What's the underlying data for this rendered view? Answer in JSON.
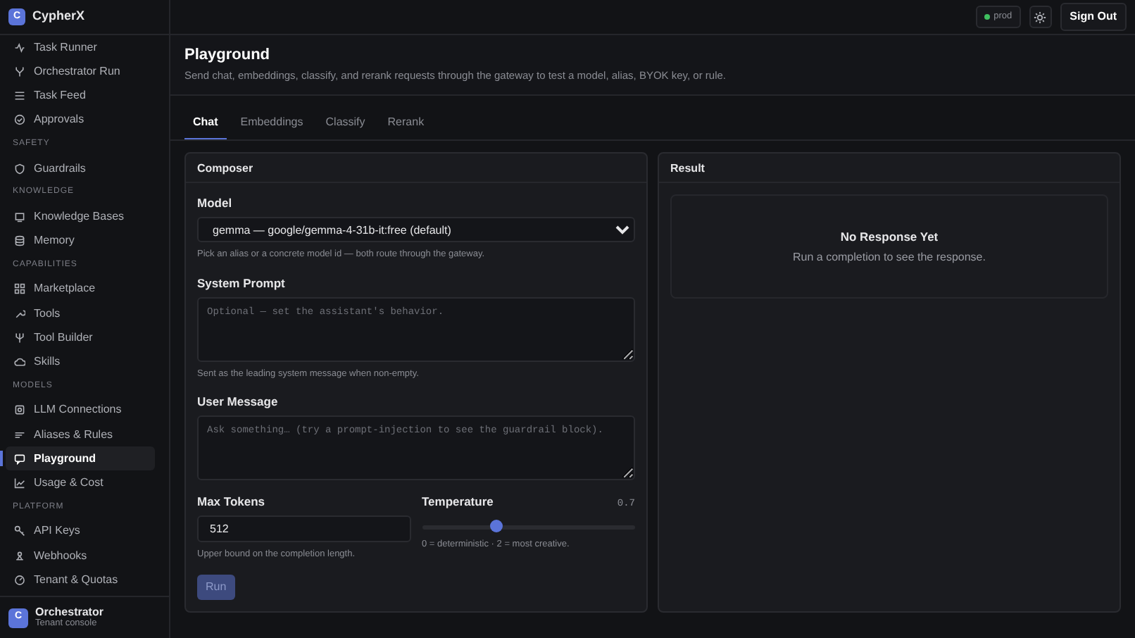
{
  "sidebar": {
    "brand": {
      "logo": "C",
      "name": "CypherX"
    },
    "sections": [
      {
        "items": [
          {
            "label": "Task Runner",
            "selected": false
          },
          {
            "label": "Orchestrator Run",
            "selected": false
          },
          {
            "label": "Task Feed",
            "selected": false
          },
          {
            "label": "Approvals",
            "selected": false
          }
        ]
      },
      {
        "heading": "SAFETY",
        "items": [
          {
            "label": "Guardrails",
            "selected": false
          }
        ]
      },
      {
        "heading": "KNOWLEDGE",
        "items": [
          {
            "label": "Knowledge Bases",
            "selected": false
          },
          {
            "label": "Memory",
            "selected": false
          }
        ]
      },
      {
        "heading": "CAPABILITIES",
        "items": [
          {
            "label": "Marketplace",
            "selected": false
          },
          {
            "label": "Tools",
            "selected": false
          },
          {
            "label": "Tool Builder",
            "selected": false
          },
          {
            "label": "Skills",
            "selected": false
          }
        ]
      },
      {
        "heading": "MODELS",
        "items": [
          {
            "label": "LLM Connections",
            "selected": false
          },
          {
            "label": "Aliases & Rules",
            "selected": false
          },
          {
            "label": "Playground",
            "selected": true
          },
          {
            "label": "Usage & Cost",
            "selected": false
          }
        ]
      },
      {
        "heading": "PLATFORM",
        "items": [
          {
            "label": "API Keys",
            "selected": false
          },
          {
            "label": "Webhooks",
            "selected": false
          },
          {
            "label": "Tenant & Quotas",
            "selected": false
          }
        ]
      }
    ],
    "footer": {
      "avatar": "C",
      "name": "Orchestrator",
      "subtitle": "Tenant console"
    }
  },
  "topbar": {
    "environment": "prod",
    "sign_out": "Sign Out"
  },
  "page": {
    "title": "Playground",
    "subtitle": "Send chat, embeddings, classify, and rerank requests through the gateway to test a model, alias, BYOK key, or rule."
  },
  "tabs": [
    {
      "label": "Chat",
      "selected": true
    },
    {
      "label": "Embeddings",
      "selected": false
    },
    {
      "label": "Classify",
      "selected": false
    },
    {
      "label": "Rerank",
      "selected": false
    }
  ],
  "composer": {
    "title": "Composer",
    "model": {
      "label": "Model",
      "value": "gemma — google/gemma-4-31b-it:free (default)",
      "help": "Pick an alias or a concrete model id — both route through the gateway."
    },
    "system_prompt": {
      "label": "System Prompt",
      "placeholder": "Optional — set the assistant's behavior.",
      "help": "Sent as the leading system message when non-empty."
    },
    "user_message": {
      "label": "User Message",
      "placeholder": "Ask something… (try a prompt-injection to see the guardrail block)."
    },
    "max_tokens": {
      "label": "Max Tokens",
      "value": "512",
      "help": "Upper bound on the completion length."
    },
    "temperature": {
      "label": "Temperature",
      "reading": "0.7",
      "level": 0.35,
      "help": "0 = deterministic · 2 = most creative."
    },
    "run": {
      "label": "Run",
      "disabled": true
    }
  },
  "result": {
    "title": "Result",
    "empty_title": "No Response Yet",
    "empty_text": "Run a completion to see the response."
  }
}
